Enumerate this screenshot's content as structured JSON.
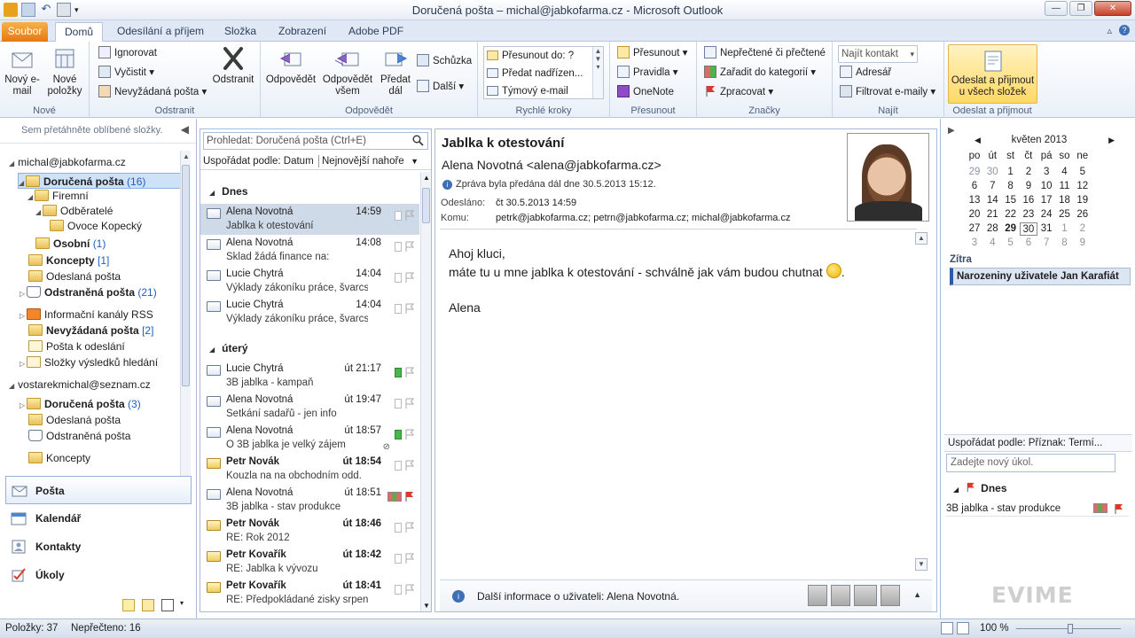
{
  "window": {
    "title": "Doručená pošta – michal@jabkofarma.cz - Microsoft Outlook"
  },
  "ribbon_tabs": [
    "Soubor",
    "Domů",
    "Odesílání a příjem",
    "Složka",
    "Zobrazení",
    "Adobe PDF"
  ],
  "ribbon": {
    "new_group": {
      "label": "Nové",
      "new_email": "Nový e-mail",
      "new_items": "Nové položky"
    },
    "delete_group": {
      "label": "Odstranit",
      "ignore": "Ignorovat",
      "cleanup": "Vyčistit",
      "junk": "Nevyžádaná pošta",
      "delete": "Odstranit"
    },
    "respond_group": {
      "label": "Odpovědět",
      "reply": "Odpovědět",
      "reply_all": "Odpovědět všem",
      "forward": "Předat dál",
      "meeting": "Schůzka",
      "more": "Další"
    },
    "quick_steps": {
      "label": "Rychlé kroky",
      "items": [
        "Přesunout do: ?",
        "Předat nadřízen...",
        "Týmový e-mail"
      ]
    },
    "move_group": {
      "label": "Přesunout",
      "move": "Přesunout",
      "rules": "Pravidla",
      "onenote": "OneNote"
    },
    "tags_group": {
      "label": "Značky",
      "unread_read": "Nepřečtené či přečtené",
      "categorize": "Zařadit do kategorií",
      "follow_up": "Zpracovat"
    },
    "find_group": {
      "label": "Najít",
      "find_contact": "Najít kontakt",
      "address_book": "Adresář",
      "filter_email": "Filtrovat e-maily"
    },
    "send_receive_group": {
      "label": "Odeslat a přijmout",
      "send_all": "Odeslat a přijmout u všech složek"
    }
  },
  "nav": {
    "favorites_hint": "Sem přetáhněte oblíbené složky.",
    "account1": "michal@jabkofarma.cz",
    "folders1": [
      {
        "name": "Doručená pošta",
        "count": "(16)"
      },
      {
        "name": "Firemní",
        "count": ""
      },
      {
        "name": "Odběratelé",
        "count": ""
      },
      {
        "name": "Ovoce Kopecký",
        "count": ""
      },
      {
        "name": "Osobní",
        "count": "(1)"
      },
      {
        "name": "Koncepty",
        "count": "[1]"
      },
      {
        "name": "Odeslaná pošta",
        "count": ""
      },
      {
        "name": "Odstraněná pošta",
        "count": "(21)"
      },
      {
        "name": "Informační kanály RSS",
        "count": ""
      },
      {
        "name": "Nevyžádaná pošta",
        "count": "[2]"
      },
      {
        "name": "Pošta k odeslání",
        "count": ""
      },
      {
        "name": "Složky výsledků hledání",
        "count": ""
      }
    ],
    "account2": "vostarekmichal@seznam.cz",
    "folders2": [
      {
        "name": "Doručená pošta",
        "count": "(3)"
      },
      {
        "name": "Odeslaná pošta",
        "count": ""
      },
      {
        "name": "Odstraněná pošta",
        "count": ""
      },
      {
        "name": "Koncepty",
        "count": ""
      }
    ],
    "modules": [
      "Pošta",
      "Kalendář",
      "Kontakty",
      "Úkoly"
    ]
  },
  "messages": {
    "search_placeholder": "Prohledat: Doručená pošta (Ctrl+E)",
    "arrange_by": "Uspořádat podle: Datum",
    "order": "Nejnovější nahoře",
    "groups": [
      "Dnes",
      "úterý"
    ],
    "today": [
      {
        "from": "Alena Novotná",
        "time": "14:59",
        "subject": "Jablka k otestování"
      },
      {
        "from": "Alena Novotná",
        "time": "14:08",
        "subject": "Sklad žádá finance na:"
      },
      {
        "from": "Lucie Chytrá",
        "time": "14:04",
        "subject": "Výklady zákoníku práce, švarcsy..."
      },
      {
        "from": "Lucie Chytrá",
        "time": "14:04",
        "subject": "Výklady zákoníku práce, švarcsy..."
      }
    ],
    "tuesday": [
      {
        "from": "Lucie Chytrá",
        "time": "út 21:17",
        "subject": "3B jablka - kampaň"
      },
      {
        "from": "Alena Novotná",
        "time": "út 19:47",
        "subject": "Setkání sadařů - jen info"
      },
      {
        "from": "Alena Novotná",
        "time": "út 18:57",
        "subject": "O 3B jablka je velký zájem"
      },
      {
        "from": "Petr Novák",
        "time": "út 18:54",
        "subject": "Kouzla na na obchodním odd."
      },
      {
        "from": "Alena Novotná",
        "time": "út 18:51",
        "subject": "3B jablka - stav produkce"
      },
      {
        "from": "Petr Novák",
        "time": "út 18:46",
        "subject": "RE: Rok 2012"
      },
      {
        "from": "Petr Kovařík",
        "time": "út 18:42",
        "subject": "RE: Jablka k vývozu"
      },
      {
        "from": "Petr Kovařík",
        "time": "út 18:41",
        "subject": "RE: Předpokládané zisky srpen ..."
      }
    ]
  },
  "reading": {
    "subject": "Jablka k otestování",
    "sender": "Alena Novotná <alena@jabkofarma.cz>",
    "info": "Zpráva byla předána dál dne 30.5.2013 15:12.",
    "sent_label": "Odesláno:",
    "sent_value": "čt 30.5.2013 14:59",
    "to_label": "Komu:",
    "to_value": "petrk@jabkofarma.cz; petrn@jabkofarma.cz; michal@jabkofarma.cz",
    "greeting": "Ahoj kluci,",
    "body": "máte tu u mne jablka k otestování - schválně jak vám budou chutnat",
    "body_end": ".",
    "signature": "Alena",
    "people_pane": "Další informace o uživateli: Alena Novotná."
  },
  "todo": {
    "month": "květen 2013",
    "weekdays": [
      "po",
      "út",
      "st",
      "čt",
      "pá",
      "so",
      "ne"
    ],
    "weeks": [
      [
        "29",
        "30",
        "1",
        "2",
        "3",
        "4",
        "5"
      ],
      [
        "6",
        "7",
        "8",
        "9",
        "10",
        "11",
        "12"
      ],
      [
        "13",
        "14",
        "15",
        "16",
        "17",
        "18",
        "19"
      ],
      [
        "20",
        "21",
        "22",
        "23",
        "24",
        "25",
        "26"
      ],
      [
        "27",
        "28",
        "29",
        "30",
        "31",
        "1",
        "2"
      ],
      [
        "3",
        "4",
        "5",
        "6",
        "7",
        "8",
        "9"
      ]
    ],
    "tomorrow_label": "Zítra",
    "appointment": "Narozeniny uživatele Jan Karafiát",
    "arrange_tasks": "Uspořádat podle: Příznak: Termí...",
    "new_task_placeholder": "Zadejte nový úkol.",
    "task_group": "Dnes",
    "task": "3B jablka - stav produkce"
  },
  "watermark": "EVIME",
  "status": {
    "items": "Položky: 37",
    "unread": "Nepřečteno: 16",
    "zoom": "100 %"
  }
}
